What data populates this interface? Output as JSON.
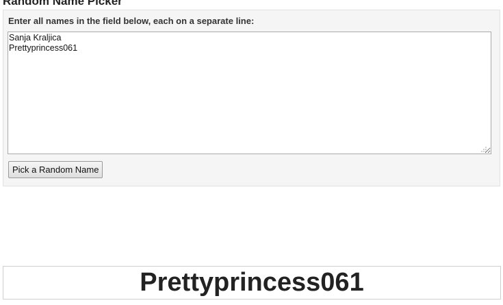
{
  "page": {
    "title": "Random Name Picker"
  },
  "picker": {
    "instructions": "Enter all names in the field below, each on a separate line:",
    "names_value": "Sanja Kraljica\nPrettyprincess061",
    "button_label": "Pick a Random Name"
  },
  "result": {
    "name": "Prettyprincess061"
  },
  "icons": {
    "resize_grip": "resize-grip-icon"
  },
  "colors": {
    "panel_background": "#f5f5f5",
    "text": "#222222"
  }
}
